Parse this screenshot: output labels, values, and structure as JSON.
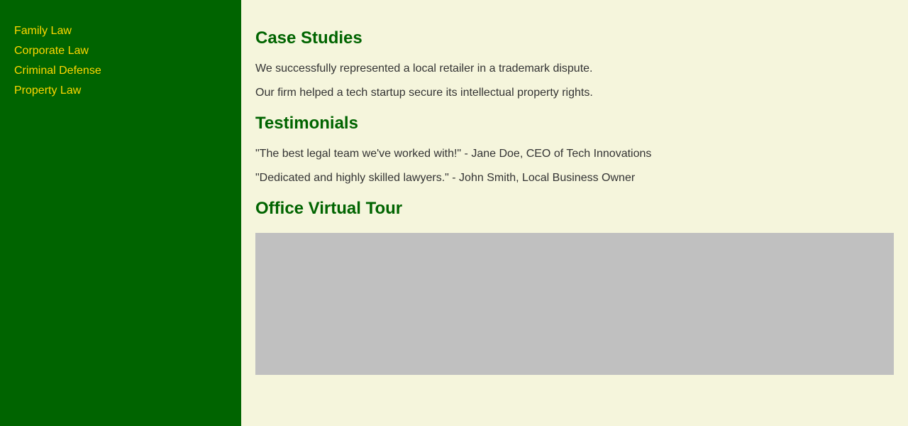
{
  "colors": {
    "sidebar_bg": "#006400",
    "link": "#ffd700",
    "page_bg": "#f5f5dc",
    "heading": "#006400",
    "text": "#333333",
    "tour_placeholder": "#c0c0c0"
  },
  "sidebar": {
    "items": [
      {
        "label": "Family Law"
      },
      {
        "label": "Corporate Law"
      },
      {
        "label": "Criminal Defense"
      },
      {
        "label": "Property Law"
      }
    ]
  },
  "main": {
    "case_studies": {
      "title": "Case Studies",
      "items": [
        "We successfully represented a local retailer in a trademark dispute.",
        "Our firm helped a tech startup secure its intellectual property rights."
      ]
    },
    "testimonials": {
      "title": "Testimonials",
      "items": [
        "\"The best legal team we've worked with!\" - Jane Doe, CEO of Tech Innovations",
        "\"Dedicated and highly skilled lawyers.\" - John Smith, Local Business Owner"
      ]
    },
    "virtual_tour": {
      "title": "Office Virtual Tour"
    }
  }
}
